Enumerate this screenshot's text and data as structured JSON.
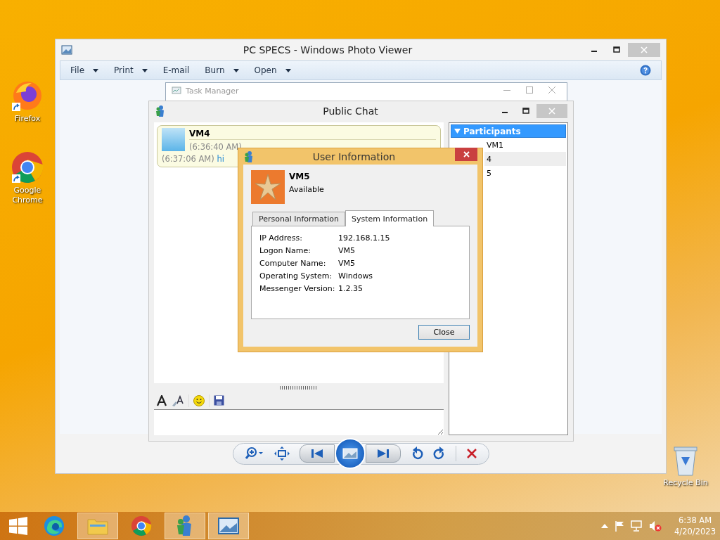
{
  "desktop_icons": [
    {
      "kind": "firefox",
      "label": "Firefox"
    },
    {
      "kind": "chrome",
      "label": "Google Chrome"
    },
    {
      "kind": "recycle",
      "label": "Recycle Bin"
    }
  ],
  "photo_viewer": {
    "title": "PC SPECS - Windows Photo Viewer",
    "menu": [
      {
        "label": "File",
        "dropdown": true
      },
      {
        "label": "Print",
        "dropdown": true
      },
      {
        "label": "E-mail",
        "dropdown": false
      },
      {
        "label": "Burn",
        "dropdown": true
      },
      {
        "label": "Open",
        "dropdown": true
      }
    ]
  },
  "task_manager": {
    "title": "Task Manager"
  },
  "public_chat": {
    "title": "Public Chat",
    "sender": "VM4",
    "messages": [
      {
        "time": "(6:36:40 AM)"
      },
      {
        "time": "(6:37:06 AM)",
        "text": "hi"
      }
    ],
    "participants": {
      "heading": "Participants",
      "expanded": true,
      "items": [
        "VM1",
        "4",
        "5"
      ]
    }
  },
  "user_info": {
    "title": "User Information",
    "name": "VM5",
    "status": "Available",
    "tabs": [
      {
        "label": "Personal Information",
        "selected": false
      },
      {
        "label": "System Information",
        "selected": true
      }
    ],
    "fields": [
      {
        "label": "IP Address:",
        "value": "192.168.1.15"
      },
      {
        "label": "Logon Name:",
        "value": "VM5"
      },
      {
        "label": "Computer Name:",
        "value": "VM5"
      },
      {
        "label": "Operating System:",
        "value": "Windows"
      },
      {
        "label": "Messenger Version:",
        "value": "1.2.35"
      }
    ],
    "close_button": "Close"
  },
  "taskbar": {
    "apps": [
      {
        "kind": "edge",
        "open": false
      },
      {
        "kind": "explorer",
        "open": true
      },
      {
        "kind": "chrome",
        "open": false
      },
      {
        "kind": "messenger",
        "open": true
      },
      {
        "kind": "photos",
        "open": true
      }
    ],
    "time": "6:38 AM",
    "date": "4/20/2023"
  }
}
